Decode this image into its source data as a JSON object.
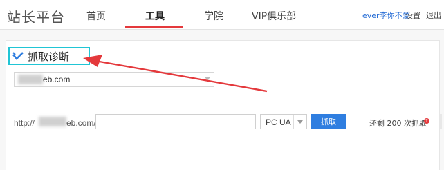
{
  "header": {
    "brand": "站长平台",
    "nav": [
      {
        "label": "首页"
      },
      {
        "label": "工具",
        "active": true
      },
      {
        "label": "学院"
      },
      {
        "label": "VIP俱乐部"
      }
    ],
    "user": "ever李你不爱",
    "settings_label": "设置",
    "logout_label": "退出"
  },
  "section": {
    "title": "抓取诊断",
    "icon": "check-icon",
    "highlight_color": "#21c5d5"
  },
  "domain_select": {
    "value_visible": "eb.com"
  },
  "url_row": {
    "prefix_start": "http://",
    "prefix_end": "eb.com/",
    "input_value": "",
    "ua_value": "PC UA",
    "fetch_label": "抓取",
    "remaining": "还剩 200 次抓取"
  },
  "colors": {
    "accent_red": "#e4393c",
    "button_blue": "#2f7ee0",
    "annotation_arrow": "#e4393c"
  }
}
